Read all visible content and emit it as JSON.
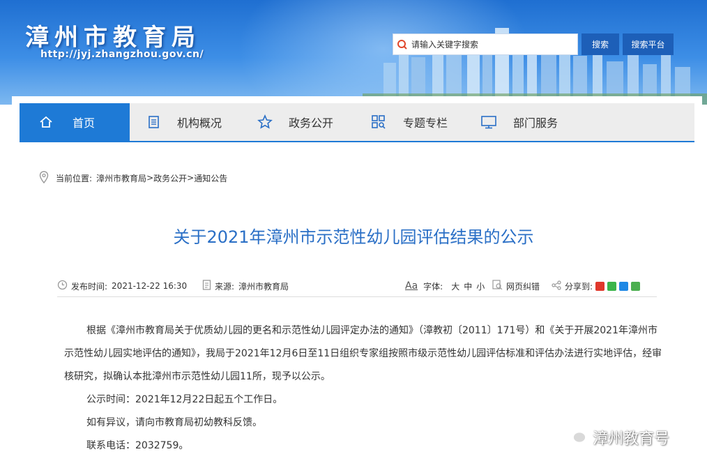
{
  "header": {
    "site_title": "漳州市教育局",
    "site_url": "http://jyj.zhangzhou.gov.cn/",
    "search_placeholder": "请输入关键字搜索",
    "search_button": "搜索",
    "platform_button": "搜索平台"
  },
  "nav": {
    "items": [
      {
        "label": "首页",
        "icon": "home-icon",
        "active": true
      },
      {
        "label": "机构概况",
        "icon": "document-icon",
        "active": false
      },
      {
        "label": "政务公开",
        "icon": "star-icon",
        "active": false
      },
      {
        "label": "专题专栏",
        "icon": "grid-search-icon",
        "active": false
      },
      {
        "label": "部门服务",
        "icon": "monitor-icon",
        "active": false
      }
    ]
  },
  "breadcrumb": {
    "prefix": "当前位置:",
    "path": [
      "漳州市教育局",
      "政务公开",
      "通知公告"
    ],
    "separator": ">"
  },
  "article": {
    "title": "关于2021年漳州市示范性幼儿园评估结果的公示",
    "meta": {
      "publish_label": "发布时间:",
      "publish_time": "2021-12-22 16:30",
      "source_label": "来源:",
      "source": "漳州市教育局",
      "font_icon_text": "Aa",
      "font_label": "字体:",
      "font_large": "大",
      "font_medium": "中",
      "font_small": "小",
      "correction": "网页纠错",
      "share_label": "分享到:"
    },
    "paragraphs": [
      "根据《漳州市教育局关于优质幼儿园的更名和示范性幼儿园评定办法的通知》（漳教初〔2011〕171号）和《关于开展2021年漳州市示范性幼儿园实地评估的通知》，我局于2021年12月6日至11日组织专家组按照市级示范性幼儿园评估标准和评估办法进行实地评估，经审核研究，拟确认本批漳州市示范性幼儿园11所，现予以公示。",
      "公示时间：2021年12月22日起五个工作日。",
      "如有异议，请向市教育局初幼教科反馈。",
      "联系电话：2032759。"
    ]
  },
  "watermark": "漳州教育号",
  "colors": {
    "accent": "#1e7ad6",
    "title": "#2a6fc6",
    "button": "#1d5fb8"
  }
}
